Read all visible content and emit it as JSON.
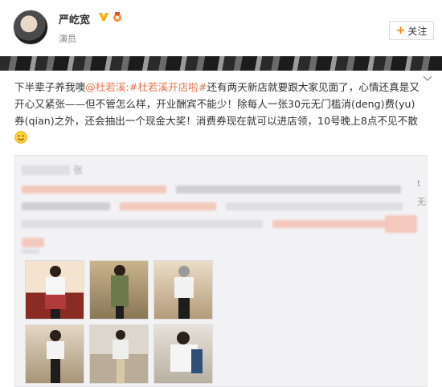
{
  "header": {
    "user_name": "严屹宽",
    "user_title": "演员",
    "follow_label": "关注",
    "plus_symbol": "+",
    "colors": {
      "name": "#333333",
      "link": "#eb7350",
      "vip": "#ffab00",
      "accent": "#ff8200"
    }
  },
  "post": {
    "text_before": "下半辈子养我噢",
    "mention": "@杜若溪",
    "hashtag": ":#杜若溪开店啦#",
    "text_after": "还有两天新店就要跟大家见面了，心情还真是又开心又紧张——但不管怎么样，开业酬宾不能少！除每人一张30元无门槛消(deng)费(yu)券(qian)之外，还会抽出一个现金大奖！消费券现在就可以进店领，10号晚上8点不见不散"
  },
  "repost": {
    "author_fragment": "张",
    "trail_fragment_1": "t",
    "trail_fragment_2": "无"
  },
  "icons": [
    "avatar",
    "vip-icon",
    "medal-icon",
    "collapse-icon",
    "smile-icon"
  ]
}
